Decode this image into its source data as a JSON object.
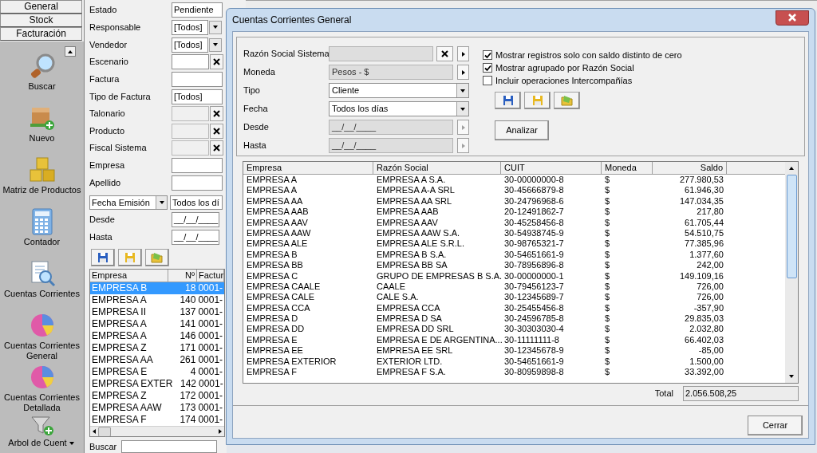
{
  "sidebar": {
    "tabs": [
      {
        "label": "General"
      },
      {
        "label": "Stock"
      },
      {
        "label": "Facturación"
      }
    ],
    "items": [
      {
        "label": "Buscar",
        "kind": "search"
      },
      {
        "label": "Nuevo",
        "kind": "new"
      },
      {
        "label": "Matriz de Productos",
        "kind": "cubes"
      },
      {
        "label": "Contador",
        "kind": "calculator"
      },
      {
        "label": "Cuentas Corrientes",
        "kind": "doc-search"
      },
      {
        "label": "Cuentas Corrientes General",
        "kind": "pie"
      },
      {
        "label": "Cuentas Corrientes Detallada",
        "kind": "pie"
      },
      {
        "label": "Arbol de Cuent",
        "kind": "funnel"
      }
    ]
  },
  "filters": [
    {
      "label": "Estado",
      "kind": "text",
      "value": "Pendiente"
    },
    {
      "label": "Responsable",
      "kind": "combo",
      "value": "[Todos]"
    },
    {
      "label": "Vendedor",
      "kind": "combo",
      "value": "[Todos]"
    },
    {
      "label": "Escenario",
      "kind": "clear",
      "disabled": false
    },
    {
      "label": "Factura",
      "kind": "text"
    },
    {
      "label": "Tipo de Factura",
      "kind": "text",
      "value": "[Todos]"
    },
    {
      "label": "Talonario",
      "kind": "clear",
      "disabled": true
    },
    {
      "label": "Producto",
      "kind": "clear",
      "disabled": true
    },
    {
      "label": "Fiscal Sistema",
      "kind": "clear",
      "disabled": true
    },
    {
      "label": "Empresa",
      "kind": "text"
    },
    {
      "label": "Apellido",
      "kind": "text"
    }
  ],
  "date_filter": {
    "field": "Fecha Emisión",
    "range": "Todos los dí",
    "from_label": "Desde",
    "from": "__/__/____",
    "to_label": "Hasta",
    "to": "__/__/____"
  },
  "list": {
    "columns": [
      "Empresa",
      "Nº",
      "Factur"
    ],
    "rows": [
      {
        "cells": [
          "EMPRESA B",
          "18",
          "0001-"
        ],
        "selected": true
      },
      {
        "cells": [
          "EMPRESA A",
          "140",
          "0001-"
        ],
        "selected": false
      },
      {
        "cells": [
          "EMPRESA II",
          "137",
          "0001-"
        ],
        "selected": false
      },
      {
        "cells": [
          "EMPRESA A",
          "141",
          "0001-"
        ],
        "selected": false
      },
      {
        "cells": [
          "EMPRESA A",
          "146",
          "0001-"
        ],
        "selected": false
      },
      {
        "cells": [
          "EMPRESA Z",
          "171",
          "0001-"
        ],
        "selected": false
      },
      {
        "cells": [
          "EMPRESA AA",
          "261",
          "0001-"
        ],
        "selected": false
      },
      {
        "cells": [
          "EMPRESA E",
          "4",
          "0001-"
        ],
        "selected": false
      },
      {
        "cells": [
          "EMPRESA EXTER",
          "142",
          "0001-"
        ],
        "selected": false
      },
      {
        "cells": [
          "EMPRESA Z",
          "172",
          "0001-"
        ],
        "selected": false
      },
      {
        "cells": [
          "EMPRESA AAW",
          "173",
          "0001-"
        ],
        "selected": false
      },
      {
        "cells": [
          "EMPRESA F",
          "174",
          "0001-"
        ],
        "selected": false
      }
    ]
  },
  "search_label": "Buscar",
  "dialog": {
    "title": "Cuentas Corrientes General",
    "fields": [
      {
        "label": "Razón Social Sistema",
        "kind": "clear-arrow",
        "disabled": true
      },
      {
        "label": "Moneda",
        "kind": "arrow",
        "value": "Pesos - $",
        "disabled": true
      },
      {
        "label": "Tipo",
        "kind": "combo",
        "value": "Cliente"
      },
      {
        "label": "Fecha",
        "kind": "combo",
        "value": "Todos los días"
      },
      {
        "label": "Desde",
        "kind": "arrow",
        "value": "__/__/____",
        "disabled": true
      },
      {
        "label": "Hasta",
        "kind": "arrow",
        "value": "__/__/____",
        "disabled": true
      }
    ],
    "options": [
      {
        "label": "Mostrar registros solo con saldo distinto de cero",
        "checked": true
      },
      {
        "label": "Mostrar agrupado por Razón Social",
        "checked": true
      },
      {
        "label": "Incluir operaciones Intercompañías",
        "checked": false
      }
    ],
    "analyze_button": "Analizar",
    "table": {
      "columns": [
        "Empresa",
        "Razón Social",
        "CUIT",
        "Moneda",
        "Saldo"
      ],
      "rows": [
        [
          "EMPRESA A",
          "EMPRESA A S.A.",
          "30-00000000-8",
          "$",
          "277.980,53"
        ],
        [
          "EMPRESA A",
          "EMPRESA A-A SRL",
          "30-45666879-8",
          "$",
          "61.946,30"
        ],
        [
          "EMPRESA AA",
          "EMPRESA AA SRL",
          "30-24796968-6",
          "$",
          "147.034,35"
        ],
        [
          "EMPRESA AAB",
          "EMPRESA AAB",
          "20-12491862-7",
          "$",
          "217,80"
        ],
        [
          "EMPRESA AAV",
          "EMPRESA AAV",
          "30-45258456-8",
          "$",
          "61.705,44"
        ],
        [
          "EMPRESA AAW",
          "EMPRESA AAW S.A.",
          "30-54938745-9",
          "$",
          "54.510,75"
        ],
        [
          "EMPRESA ALE",
          "EMPRESA ALE S.R.L.",
          "30-98765321-7",
          "$",
          "77.385,96"
        ],
        [
          "EMPRESA B",
          "EMPRESA B S.A.",
          "30-54651661-9",
          "$",
          "1.377,60"
        ],
        [
          "EMPRESA BB",
          "EMPRESA BB SA",
          "30-78956896-8",
          "$",
          "242,00"
        ],
        [
          "EMPRESA C",
          "GRUPO DE EMPRESAS B S.A.",
          "30-00000000-1",
          "$",
          "149.109,16"
        ],
        [
          "EMPRESA CAALE",
          "CAALE",
          "30-79456123-7",
          "$",
          "726,00"
        ],
        [
          "EMPRESA CALE",
          "CALE S.A.",
          "30-12345689-7",
          "$",
          "726,00"
        ],
        [
          "EMPRESA CCA",
          "EMPRESA CCA",
          "30-25455456-8",
          "$",
          "-357,90"
        ],
        [
          "EMPRESA D",
          "EMPRESA D SA",
          "30-24596785-8",
          "$",
          "29.835,03"
        ],
        [
          "EMPRESA DD",
          "EMPRESA DD SRL",
          "30-30303030-4",
          "$",
          "2.032,80"
        ],
        [
          "EMPRESA E",
          "EMPRESA E DE ARGENTINA...",
          "30-11111111-8",
          "$",
          "66.402,03"
        ],
        [
          "EMPRESA EE",
          "EMPRESA EE SRL",
          "30-12345678-9",
          "$",
          "-85,00"
        ],
        [
          "EMPRESA EXTERIOR",
          "EXTERIOR LTD.",
          "30-54651661-9",
          "$",
          "1.500,00"
        ],
        [
          "EMPRESA F",
          "EMPRESA F S.A.",
          "30-80959898-8",
          "$",
          "33.392,00"
        ]
      ]
    },
    "total_label": "Total",
    "total": "2.056.508,25",
    "close_button": "Cerrar"
  }
}
